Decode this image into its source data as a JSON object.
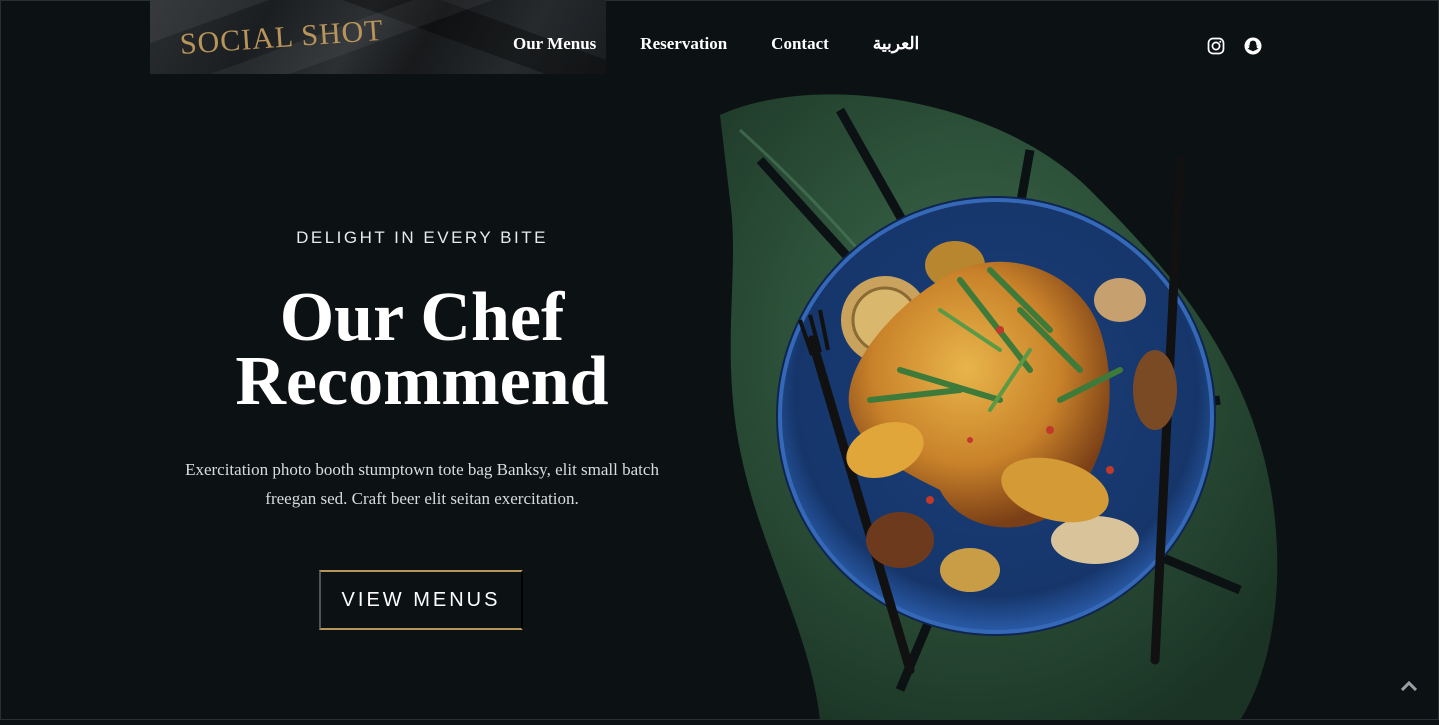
{
  "brand": {
    "logo_text": "SOCIAL SHOT"
  },
  "nav": {
    "items": [
      {
        "label": "Our Menus"
      },
      {
        "label": "Reservation"
      },
      {
        "label": "Contact"
      },
      {
        "label": "العربية"
      }
    ]
  },
  "social": {
    "icons": [
      "instagram-icon",
      "snapchat-icon"
    ]
  },
  "hero": {
    "eyebrow": "DELIGHT IN EVERY BITE",
    "title_line1": "Our Chef",
    "title_line2": "Recommend",
    "description": "Exercitation photo booth stumptown tote bag Banksy, elit small batch freegan sed. Craft beer elit seitan exercitation.",
    "cta_label": "VIEW MENUS"
  },
  "colors": {
    "background": "#0c1114",
    "accent_gold": "#b8955a",
    "plate_blue": "#1e4a8c",
    "leaf_green": "#2f5a3c"
  },
  "scroll_to_top": {
    "icon": "chevron-up-icon"
  }
}
